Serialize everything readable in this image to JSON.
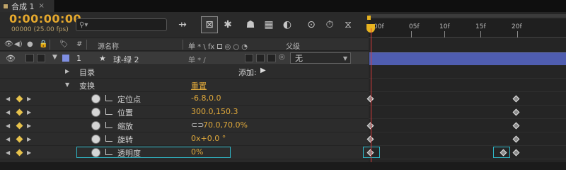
{
  "tab": {
    "title": "合成 1",
    "close": "×"
  },
  "timecode": "0:00:00:00",
  "fps_info": "00000 (25.00 fps)",
  "search": {
    "placeholder": "",
    "icon": "search-icon"
  },
  "header": {
    "source_name": "源名称",
    "switches": "单 * \\ fx 🞐 ◎ ○ ◔",
    "parent": "父级",
    "number_sign": "#"
  },
  "layer": {
    "number": "1",
    "name": "球-绿 2",
    "parent_value": "无",
    "color": "#7f8fe2"
  },
  "groups": [
    {
      "label": "目录",
      "extra": "添加:"
    },
    {
      "label": "变换",
      "extra": "重置"
    }
  ],
  "properties": [
    {
      "name": "定位点",
      "value": "-6.8,0.0"
    },
    {
      "name": "位置",
      "value": "300.0,150.3"
    },
    {
      "name": "缩放",
      "value": "70.0,70.0%"
    },
    {
      "name": "旋转",
      "value": "0x+0.0 °"
    },
    {
      "name": "透明度",
      "value": "0%"
    }
  ],
  "ruler": {
    "labels": [
      "00f",
      "05f",
      "10f",
      "15f",
      "20f"
    ]
  }
}
